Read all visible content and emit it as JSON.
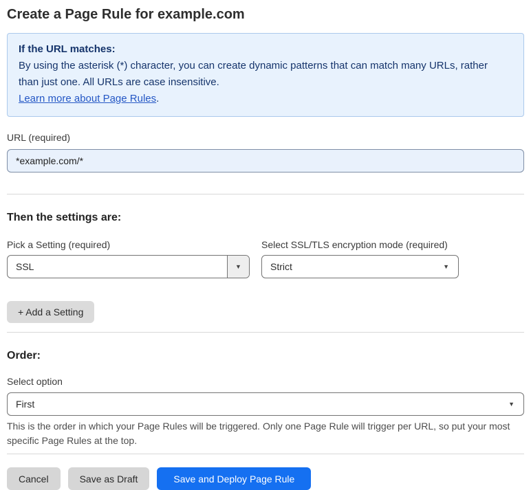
{
  "page": {
    "title": "Create a Page Rule for example.com"
  },
  "info_box": {
    "heading": "If the URL matches:",
    "body": "By using the asterisk (*) character, you can create dynamic patterns that can match many URLs, rather than just one. All URLs are case insensitive.",
    "link_label": "Learn more about Page Rules",
    "link_suffix": "."
  },
  "url_field": {
    "label": "URL (required)",
    "value": "*example.com/*"
  },
  "settings_section": {
    "heading": "Then the settings are:",
    "setting_select": {
      "label": "Pick a Setting (required)",
      "value": "SSL"
    },
    "mode_select": {
      "label": "Select SSL/TLS encryption mode (required)",
      "value": "Strict"
    },
    "add_button_label": "+ Add a Setting"
  },
  "order_section": {
    "heading": "Order:",
    "select_label": "Select option",
    "select_value": "First",
    "help_text": "This is the order in which your Page Rules will be triggered. Only one Page Rule will trigger per URL, so put your most specific Page Rules at the top."
  },
  "footer": {
    "cancel_label": "Cancel",
    "save_draft_label": "Save as Draft",
    "save_deploy_label": "Save and Deploy Page Rule"
  },
  "icons": {
    "dropdown_caret": "▼"
  },
  "colors": {
    "info_bg": "#e8f2fd",
    "info_border": "#abc9ec",
    "info_text": "#15346b",
    "link_blue": "#2457c5",
    "input_bg": "#e9f1fc",
    "primary_blue": "#1570f1",
    "button_gray": "#d6d6d6"
  }
}
